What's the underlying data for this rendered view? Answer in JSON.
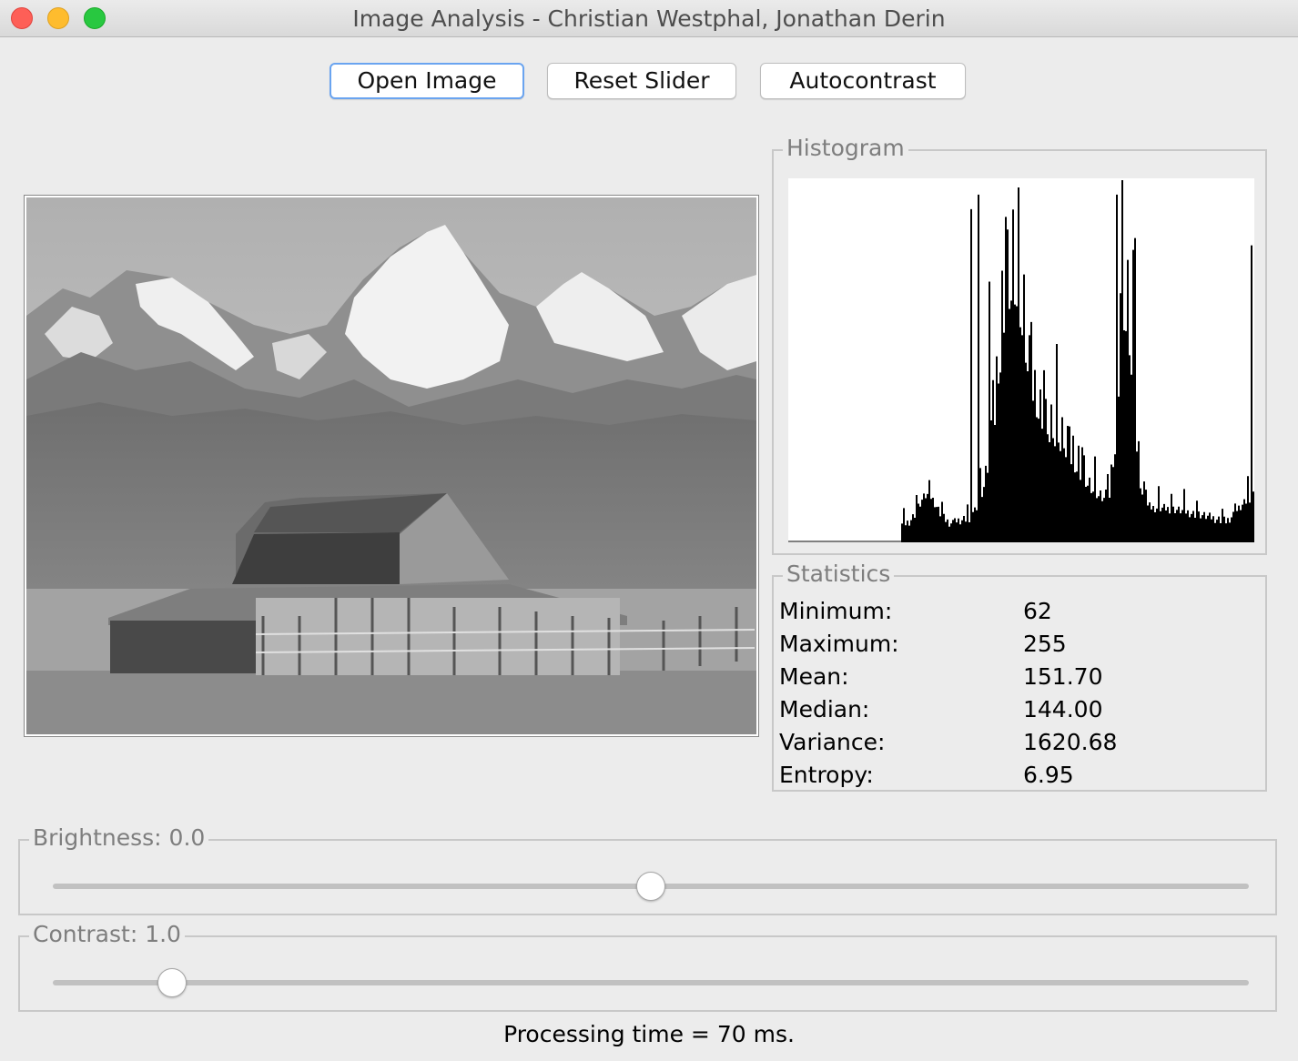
{
  "window": {
    "title": "Image Analysis - Christian Westphal, Jonathan Derin",
    "controls": [
      "close",
      "minimize",
      "zoom"
    ]
  },
  "toolbar": {
    "open_image_label": "Open Image",
    "reset_slider_label": "Reset Slider",
    "autocontrast_label": "Autocontrast"
  },
  "image": {
    "icon": "grayscale-barn-mountains-photo"
  },
  "histogram": {
    "title": "Histogram"
  },
  "statistics": {
    "title": "Statistics",
    "rows": [
      {
        "label": "Minimum:",
        "value": "62"
      },
      {
        "label": "Maximum:",
        "value": "255"
      },
      {
        "label": "Mean:",
        "value": "151.70"
      },
      {
        "label": "Median:",
        "value": "144.00"
      },
      {
        "label": "Variance:",
        "value": "1620.68"
      },
      {
        "label": "Entropy:",
        "value": "6.95"
      }
    ]
  },
  "brightness": {
    "label": "Brightness: 0.0",
    "level": 0.5
  },
  "contrast": {
    "label": "Contrast: 1.0",
    "level": 0.1
  },
  "status": {
    "text": "Processing time = 70 ms."
  },
  "colors": {
    "default_button_ring": "#6aa4f0",
    "close": "#fe5f57",
    "minimize": "#febc2e",
    "zoom": "#28c840"
  }
}
